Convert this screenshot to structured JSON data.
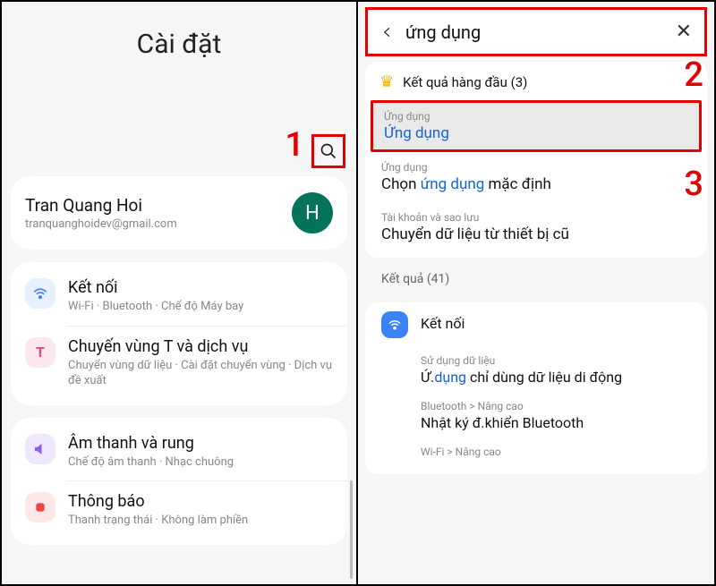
{
  "left": {
    "title": "Cài đặt",
    "account": {
      "name": "Tran Quang Hoi",
      "email": "tranquanghoidev@gmail.com",
      "initial": "H"
    },
    "groups": [
      {
        "rows": [
          {
            "title": "Kết nối",
            "sub": "Wi-Fi · Bluetooth · Chế độ Máy bay",
            "iconColor": "#3b82f6",
            "icon": "wifi"
          },
          {
            "title": "Chuyến vùng T và dịch vụ",
            "sub": "Chuyển vùng dữ liệu · Cài đặt chuyển vùng · Dịch vụ đề xuất",
            "iconColor": "#e4467e",
            "icon": "t"
          }
        ]
      },
      {
        "rows": [
          {
            "title": "Âm thanh và rung",
            "sub": "Chế độ âm thanh · Nhạc chuông",
            "iconColor": "#8b5cf6",
            "icon": "sound"
          },
          {
            "title": "Thông báo",
            "sub": "Thanh trạng thái · Không làm phiền",
            "iconColor": "#ef4444",
            "icon": "notif"
          }
        ]
      }
    ]
  },
  "right": {
    "query": "ứng dụng",
    "topLabel": "Kết quả hàng đầu (3)",
    "topResults": [
      {
        "cat": "Ứng dụng",
        "pre": "",
        "hl": "Ứng dụng",
        "post": ""
      },
      {
        "cat": "Ứng dụng",
        "pre": "Chọn ",
        "hl": "ứng dụng",
        "post": " mặc định"
      },
      {
        "cat": "Tài khoản và sao lưu",
        "pre": "Chuyển dữ liệu từ thiết bị cũ",
        "hl": "",
        "post": ""
      }
    ],
    "resultsLabel": "Kết quả (41)",
    "results": [
      {
        "cat": "",
        "title": "Kết nối",
        "hasIcon": true
      },
      {
        "cat": "Sử dụng dữ liệu",
        "pre": "Ứ.",
        "hl": "dụng",
        "post": " chỉ dùng dữ liệu di động"
      },
      {
        "cat": "Bluetooth > Nâng cao",
        "pre": "Nhật ký đ.khiển Bluetooth",
        "hl": "",
        "post": ""
      },
      {
        "cat": "Wi-Fi > Nâng cao",
        "pre": "",
        "hl": "",
        "post": ""
      }
    ]
  },
  "annotations": {
    "n1": "1",
    "n2": "2",
    "n3": "3"
  }
}
